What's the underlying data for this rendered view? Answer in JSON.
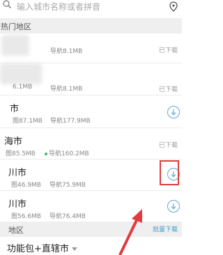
{
  "search": {
    "placeholder": "输入城市名称或者拼音"
  },
  "hot_section": {
    "title": "热门地区"
  },
  "rows": [
    {
      "name": "",
      "size1": "",
      "size2": "导航8.1MB",
      "status": "已下载"
    },
    {
      "name": "",
      "size1": "6.1MB",
      "size2": "导航8.1MB",
      "status": "已下载"
    },
    {
      "name": "市",
      "size1": "图87.1MB",
      "size2": "导航177.9MB",
      "status": ""
    },
    {
      "name": "海市",
      "size1": "图85.5MB",
      "size2": "导航160.2MB",
      "status": "已下载"
    },
    {
      "name": "川市",
      "size1": "图46.9MB",
      "size2": "导航75.9MB",
      "status": ""
    },
    {
      "name": "川市",
      "size1": "图56.6MB",
      "size2": "导航76.4MB",
      "status": ""
    }
  ],
  "bottom_section": {
    "title": "地区",
    "batch_label": "批量下载"
  },
  "last_row": {
    "name": "功能包+直辖市"
  }
}
